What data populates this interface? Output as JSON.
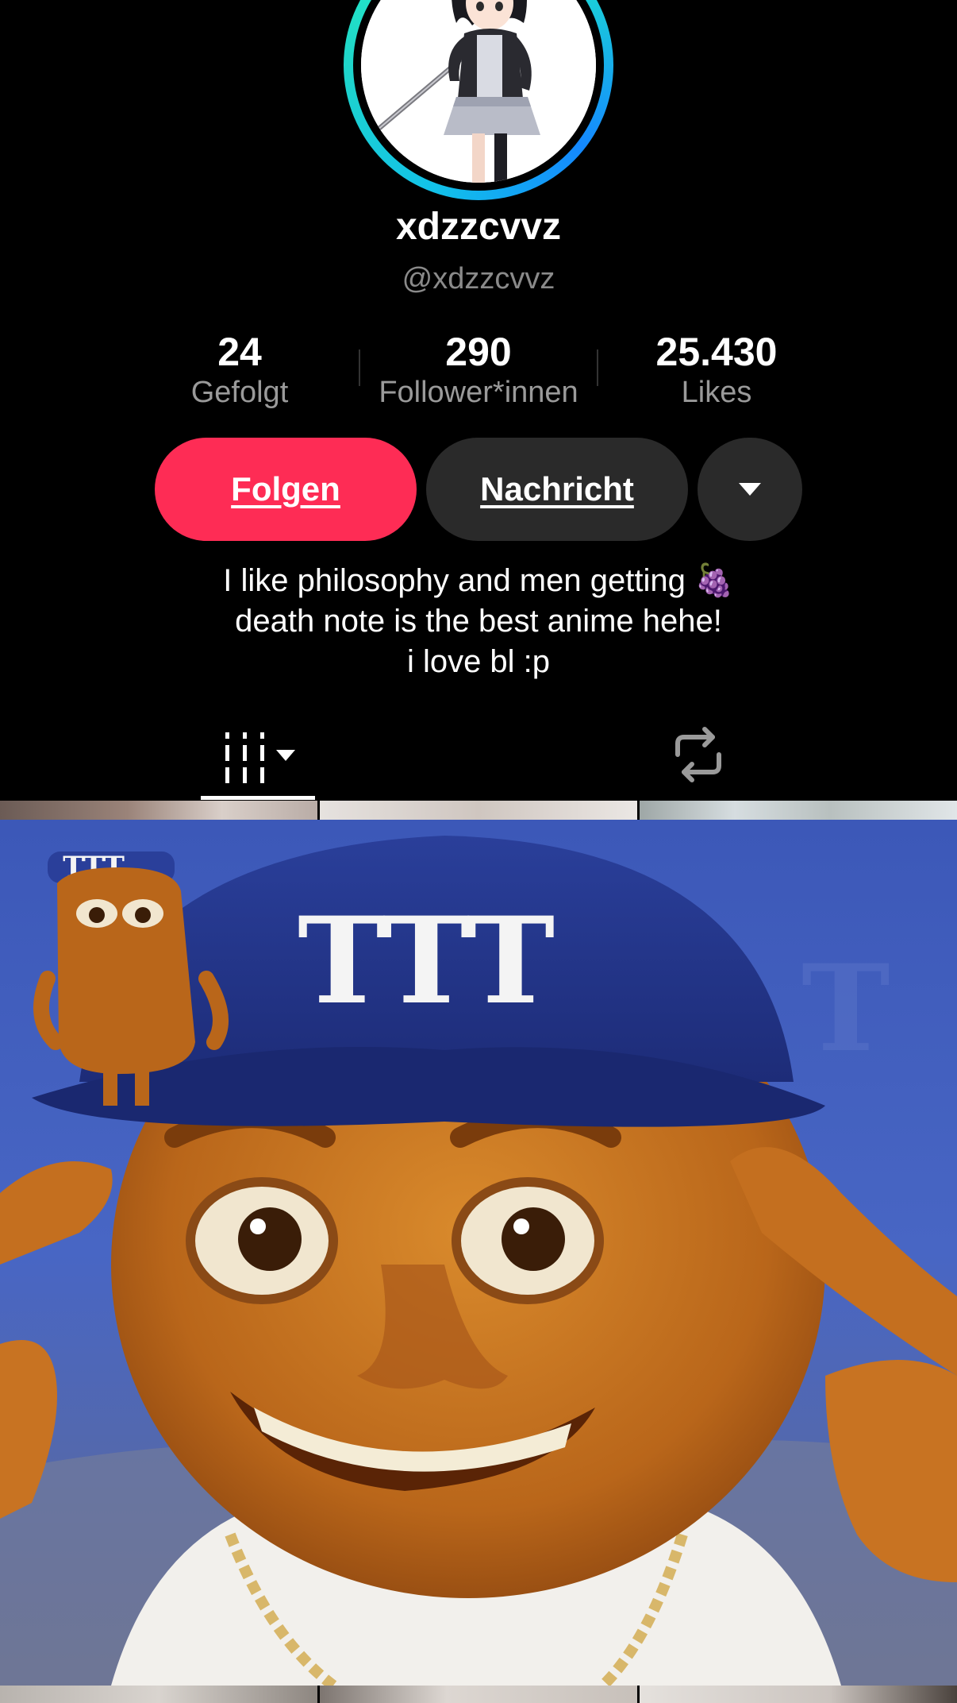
{
  "profile": {
    "display_name": "xdzzcvvz",
    "username": "@xdzzcvvz",
    "avatar_icon": "anime-girl-with-sword-avatar"
  },
  "stats": [
    {
      "value": "24",
      "label": "Gefolgt"
    },
    {
      "value": "290",
      "label": "Follower*innen"
    },
    {
      "value": "25.430",
      "label": "Likes"
    }
  ],
  "actions": {
    "follow_label": "Folgen",
    "message_label": "Nachricht",
    "more_icon": "chevron-down-icon"
  },
  "bio": {
    "lines": [
      "I like philosophy and men getting 🍇",
      "death note is the best anime hehe!",
      "i love bl :p"
    ]
  },
  "tabs": [
    {
      "icon": "videos-grid-icon",
      "selected": true
    },
    {
      "icon": "repost-icon",
      "selected": false
    }
  ],
  "video_preview": {
    "cap_text": "TTT",
    "small_cap_text": "TTT"
  },
  "colors": {
    "accent": "#fe2c55",
    "button_dark": "#2a2a2a",
    "ring_start": "#12c2e9",
    "ring_end": "#25f4c5",
    "cap_blue": "#2c3f9e",
    "skin": "#c8701e"
  }
}
